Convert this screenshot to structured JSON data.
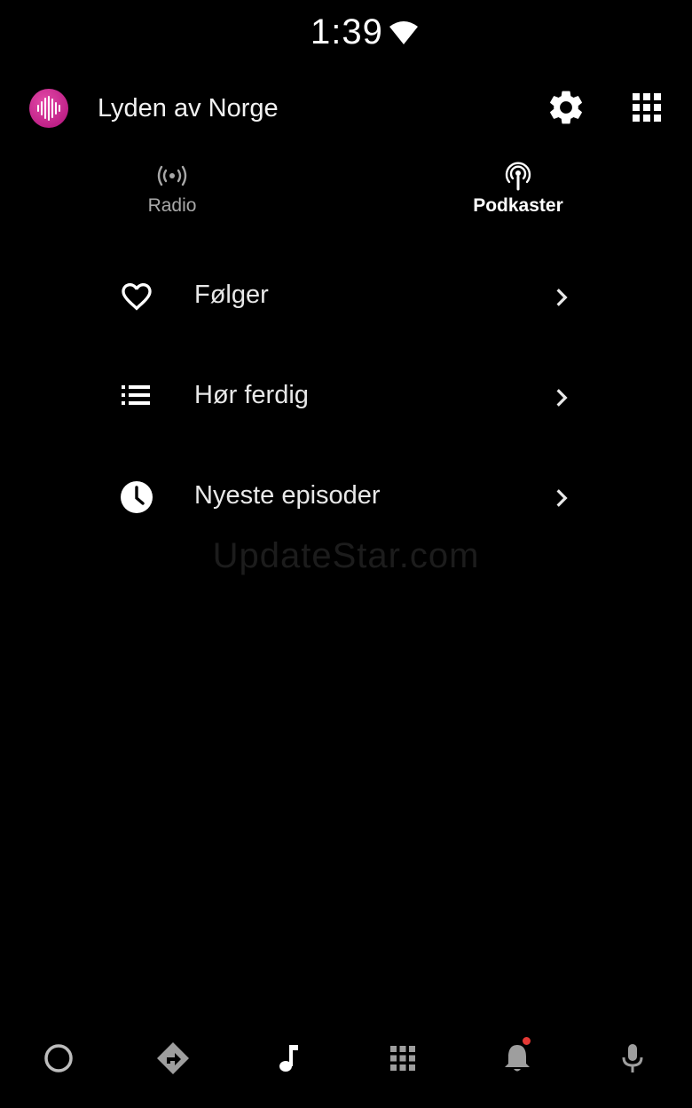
{
  "status_bar": {
    "time": "1:39",
    "wifi_icon": "wifi-full-icon"
  },
  "header": {
    "app_logo_icon": "waveform-logo-icon",
    "title": "Lyden av Norge",
    "settings_icon": "gear-icon",
    "apps_icon": "apps-grid-icon"
  },
  "tabs": [
    {
      "label": "Radio",
      "icon": "radio-broadcast-icon",
      "selected": false
    },
    {
      "label": "Podkaster",
      "icon": "podcast-icon",
      "selected": true
    }
  ],
  "list": [
    {
      "label": "Følger",
      "icon": "heart-outline-icon"
    },
    {
      "label": "Hør ferdig",
      "icon": "list-icon"
    },
    {
      "label": "Nyeste episoder",
      "icon": "clock-icon"
    }
  ],
  "watermark": "UpdateStar.com",
  "bottom_nav": [
    {
      "name": "home",
      "icon": "circle-home-icon"
    },
    {
      "name": "navigation",
      "icon": "directions-icon"
    },
    {
      "name": "media",
      "icon": "music-note-icon",
      "active": true
    },
    {
      "name": "apps",
      "icon": "apps-grid-icon"
    },
    {
      "name": "notifications",
      "icon": "bell-icon",
      "has_badge": true
    },
    {
      "name": "voice",
      "icon": "microphone-icon"
    }
  ],
  "colors": {
    "background": "#000000",
    "brand": "#c8198a",
    "notification_badge": "#e53935",
    "inactive_text": "#a8a8a8"
  }
}
